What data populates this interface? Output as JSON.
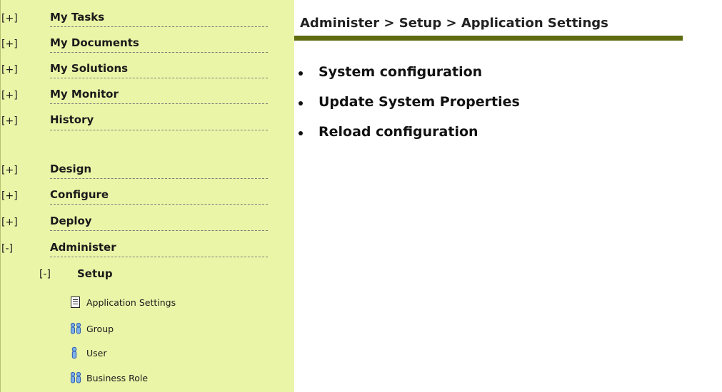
{
  "sidebar": {
    "items": [
      {
        "toggle": "[+]",
        "label": "My Tasks"
      },
      {
        "toggle": "[+]",
        "label": "My Documents"
      },
      {
        "toggle": "[+]",
        "label": "My Solutions"
      },
      {
        "toggle": "[+]",
        "label": "My Monitor"
      },
      {
        "toggle": "[+]",
        "label": "History"
      },
      {
        "toggle": "[+]",
        "label": "Design"
      },
      {
        "toggle": "[+]",
        "label": "Configure"
      },
      {
        "toggle": "[+]",
        "label": "Deploy"
      },
      {
        "toggle": "[-]",
        "label": "Administer"
      }
    ],
    "setup": {
      "toggle": "[-]",
      "label": "Setup"
    },
    "leaves": [
      {
        "label": "Application Settings",
        "icon": "document-icon"
      },
      {
        "label": "Group",
        "icon": "group-icon"
      },
      {
        "label": "User",
        "icon": "user-icon"
      },
      {
        "label": "Business Role",
        "icon": "group-icon"
      }
    ]
  },
  "content": {
    "breadcrumb": "Administer > Setup > Application Settings",
    "links": [
      "System configuration",
      "Update System Properties",
      "Reload configuration"
    ]
  },
  "colors": {
    "sidebar_bg": "#ebf5a8",
    "title_rule": "#5e6b10",
    "icon_blue": "#2a5db0"
  }
}
